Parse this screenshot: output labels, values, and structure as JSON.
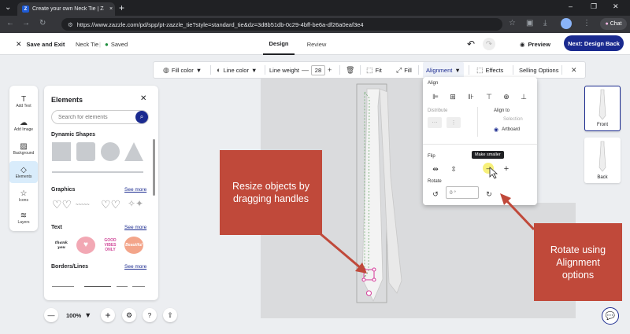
{
  "browser": {
    "tab_title": "Create your own Neck Tie | Zazzle",
    "favicon_letter": "Z",
    "tab_close": "×",
    "new_tab": "+",
    "url": "https://www.zazzle.com/pd/spp/pt-zazzle_tie?style=standard_tie&dz=3d8b51db-0c29-4bff-be6a-df26a0eaf3e4",
    "chat_label": "Chat",
    "window_controls": [
      "–",
      "❐",
      "✕"
    ]
  },
  "header": {
    "save_exit": "Save and Exit",
    "product": "Neck Tie",
    "saved": "Saved",
    "tabs": [
      "Design",
      "Review"
    ],
    "preview": "Preview",
    "next": "Next: Design Back"
  },
  "toolbar": {
    "fill_color": "Fill color",
    "line_color": "Line color",
    "line_weight": "Line weight",
    "weight_value": "28",
    "fit": "Fit",
    "fill": "Fill",
    "alignment": "Alignment",
    "effects": "Effects",
    "selling": "Selling Options"
  },
  "rail": [
    {
      "label": "Add Text",
      "icon": "T"
    },
    {
      "label": "Add Image",
      "icon": "☁"
    },
    {
      "label": "Background",
      "icon": "▨"
    },
    {
      "label": "Elements",
      "icon": "◇"
    },
    {
      "label": "Icons",
      "icon": "☆"
    },
    {
      "label": "Layers",
      "icon": "≋"
    }
  ],
  "panel": {
    "title": "Elements",
    "search_placeholder": "Search for elements",
    "sections": [
      "Dynamic Shapes",
      "Graphics",
      "Text",
      "Borders/Lines"
    ],
    "see_more": "See more",
    "text_art": [
      "thank you",
      "♥",
      "GOOD VIBES ONLY",
      "Beautiful"
    ]
  },
  "zoom": {
    "value": "100%"
  },
  "thumbs": [
    "Front",
    "Back"
  ],
  "popup": {
    "align": "Align",
    "distribute": "Distribute",
    "align_to": "Align to",
    "selection": "Selection",
    "artboard": "Artboard",
    "flip": "Flip",
    "rotate": "Rotate",
    "rotate_value": "0 °",
    "tooltip": "Make smaller"
  },
  "annotations": {
    "resize": "Resize objects by dragging handles",
    "rotate": "Rotate using Alignment options"
  },
  "colors": {
    "brand_navy": "#1a2a8f",
    "callout_red": "#c0493a",
    "saved_green": "#1e8e3e"
  }
}
